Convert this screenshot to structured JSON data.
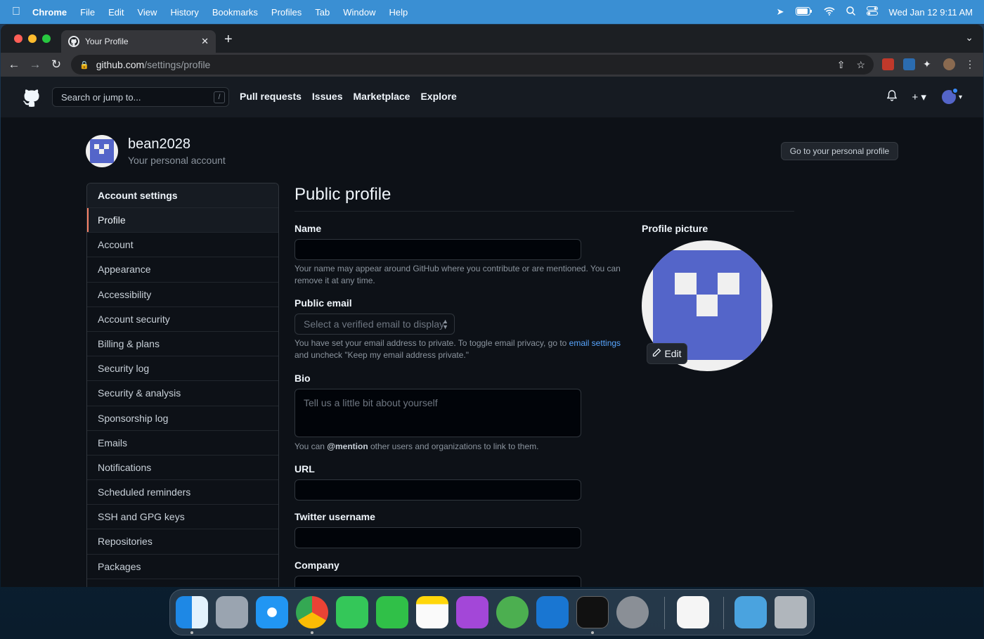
{
  "menubar": {
    "app": "Chrome",
    "items": [
      "File",
      "Edit",
      "View",
      "History",
      "Bookmarks",
      "Profiles",
      "Tab",
      "Window",
      "Help"
    ],
    "clock": "Wed Jan 12  9:11 AM"
  },
  "browser": {
    "tab_title": "Your Profile",
    "url_host": "github.com",
    "url_path": "/settings/profile"
  },
  "header": {
    "search_placeholder": "Search or jump to...",
    "search_shortcut": "/",
    "nav": [
      "Pull requests",
      "Issues",
      "Marketplace",
      "Explore"
    ]
  },
  "context": {
    "username": "bean2028",
    "subtitle": "Your personal account",
    "go_profile_label": "Go to your personal profile"
  },
  "sidebar": {
    "heading": "Account settings",
    "items": [
      {
        "label": "Profile",
        "active": true
      },
      {
        "label": "Account"
      },
      {
        "label": "Appearance"
      },
      {
        "label": "Accessibility"
      },
      {
        "label": "Account security"
      },
      {
        "label": "Billing & plans"
      },
      {
        "label": "Security log"
      },
      {
        "label": "Security & analysis"
      },
      {
        "label": "Sponsorship log"
      },
      {
        "label": "Emails"
      },
      {
        "label": "Notifications"
      },
      {
        "label": "Scheduled reminders"
      },
      {
        "label": "SSH and GPG keys"
      },
      {
        "label": "Repositories"
      },
      {
        "label": "Packages"
      }
    ]
  },
  "main": {
    "title": "Public profile",
    "name_label": "Name",
    "name_note": "Your name may appear around GitHub where you contribute or are mentioned. You can remove it at any time.",
    "email_label": "Public email",
    "email_placeholder": "Select a verified email to display",
    "email_note_pre": "You have set your email address to private. To toggle email privacy, go to",
    "email_note_link": "email settings",
    "email_note_post": "and uncheck \"Keep my email address private.\"",
    "bio_label": "Bio",
    "bio_placeholder": "Tell us a little bit about yourself",
    "bio_note_pre": "You can",
    "bio_note_mention": "@mention",
    "bio_note_post": "other users and organizations to link to them.",
    "url_label": "URL",
    "twitter_label": "Twitter username",
    "company_label": "Company",
    "picture_label": "Profile picture",
    "edit_label": "Edit"
  },
  "colors": {
    "menubar": "#3a8fd3",
    "page_bg": "#0d1117",
    "header_bg": "#161b22",
    "avatar": "#5465c9",
    "active_indicator": "#f78166",
    "link": "#58a6ff"
  },
  "dock": {
    "apps": [
      "finder",
      "launchpad",
      "safari",
      "chrome",
      "messages",
      "facetime",
      "notes",
      "podcasts",
      "linear",
      "xcode",
      "terminal",
      "system-preferences",
      "textedit",
      "downloads",
      "trash"
    ]
  }
}
